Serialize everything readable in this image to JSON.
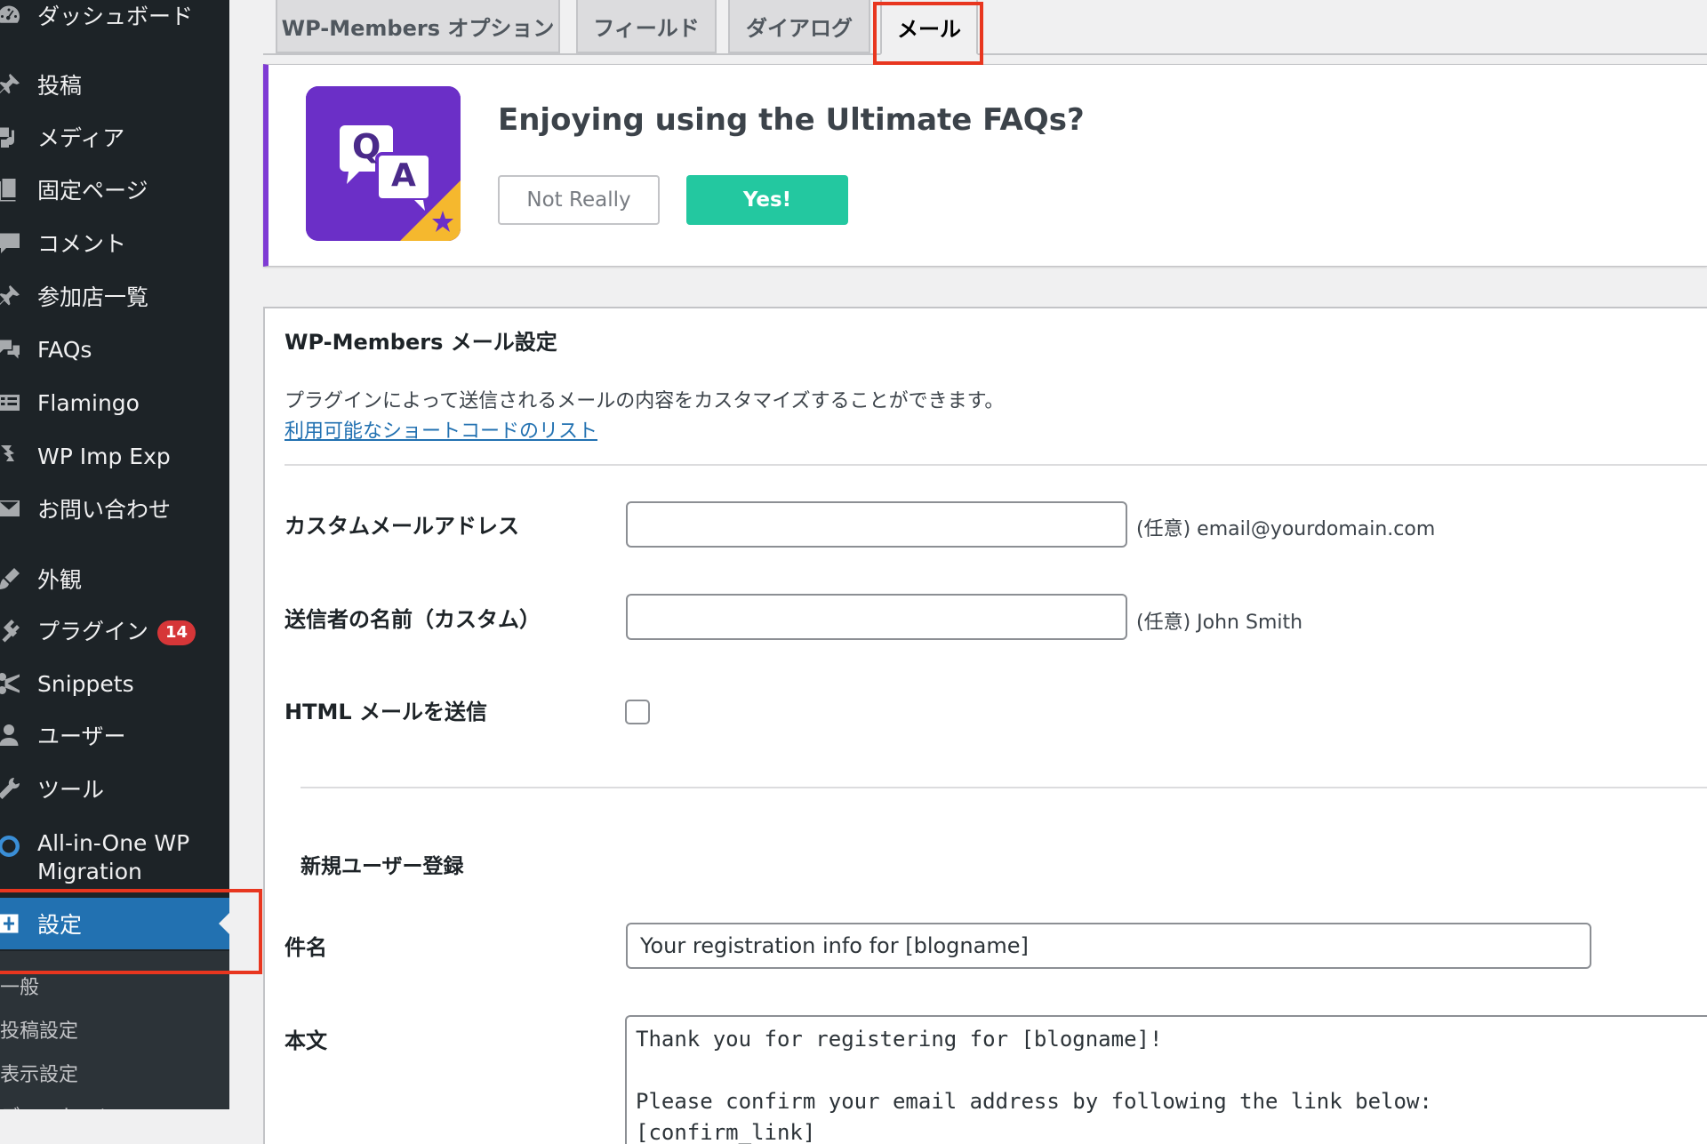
{
  "sidebar": {
    "items": [
      {
        "key": "dashboard",
        "label": "ダッシュボード",
        "icon": "dashboard-icon"
      },
      {
        "key": "posts",
        "label": "投稿",
        "icon": "pin-icon"
      },
      {
        "key": "media",
        "label": "メディア",
        "icon": "media-icon"
      },
      {
        "key": "pages",
        "label": "固定ページ",
        "icon": "page-icon"
      },
      {
        "key": "comments",
        "label": "コメント",
        "icon": "comment-icon"
      },
      {
        "key": "shops",
        "label": "参加店一覧",
        "icon": "pin-icon"
      },
      {
        "key": "faqs",
        "label": "FAQs",
        "icon": "chat-bubbles-icon"
      },
      {
        "key": "flamingo",
        "label": "Flamingo",
        "icon": "list-icon"
      },
      {
        "key": "wpimpexp",
        "label": "WP Imp Exp",
        "icon": "transfer-icon"
      },
      {
        "key": "contact",
        "label": "お問い合わせ",
        "icon": "mail-icon"
      },
      {
        "key": "appearance",
        "label": "外観",
        "icon": "brush-icon"
      },
      {
        "key": "plugins",
        "label": "プラグイン",
        "icon": "plugin-icon",
        "badge": "14"
      },
      {
        "key": "snippets",
        "label": "Snippets",
        "icon": "scissors-icon"
      },
      {
        "key": "users",
        "label": "ユーザー",
        "icon": "user-icon"
      },
      {
        "key": "tools",
        "label": "ツール",
        "icon": "wrench-icon"
      },
      {
        "key": "migration",
        "label": "All-in-One WP Migration",
        "icon": "migration-icon"
      },
      {
        "key": "settings",
        "label": "設定",
        "icon": "settings-icon",
        "current": true
      }
    ],
    "submenu": [
      "一般",
      "投稿設定",
      "表示設定",
      "ディスカッション"
    ]
  },
  "tabs": [
    {
      "label": "WP-Members オプション"
    },
    {
      "label": "フィールド"
    },
    {
      "label": "ダイアログ"
    },
    {
      "label": "メール",
      "active": true
    }
  ],
  "notice": {
    "title": "Enjoying using the Ultimate FAQs?",
    "btn_no": "Not Really",
    "btn_yes": "Yes!",
    "logo_q": "Q",
    "logo_a": "A"
  },
  "panel": {
    "title": "WP-Members メール設定",
    "description": "プラグインによって送信されるメールの内容をカスタマイズすることができます。",
    "link": "利用可能なショートコードのリスト",
    "fields": {
      "custom_email": {
        "label": "カスタムメールアドレス",
        "value": "",
        "hint": "(任意) email@yourdomain.com"
      },
      "sender_name": {
        "label": "送信者の名前（カスタム）",
        "value": "",
        "hint": "(任意) John Smith"
      },
      "html_mail": {
        "label": "HTML メールを送信",
        "checked": false
      }
    },
    "section": "新規ユーザー登録",
    "subject": {
      "label": "件名",
      "value": "Your registration info for [blogname]"
    },
    "body": {
      "label": "本文",
      "value": "Thank you for registering for [blogname]!\n\nPlease confirm your email address by following the link below:\n[confirm_link]"
    }
  },
  "colors": {
    "sidebar_bg": "#1d2327",
    "accent_blue": "#2271b1",
    "highlight_red": "#e8361f",
    "notice_purple": "#7f3bd4",
    "yes_green": "#23c8a0",
    "badge_red": "#d63638"
  }
}
